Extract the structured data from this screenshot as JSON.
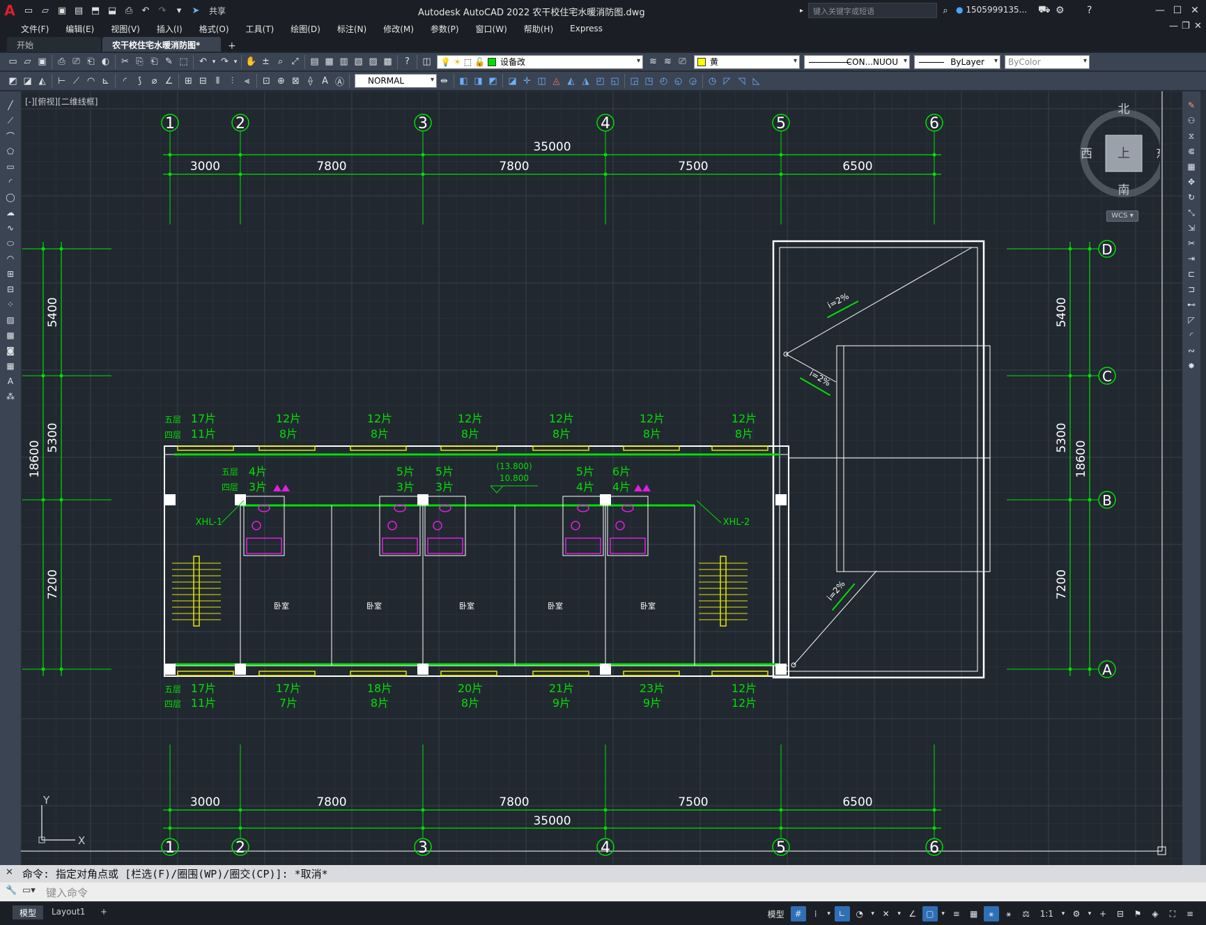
{
  "app": {
    "title": "Autodesk AutoCAD 2022    农干校住宅水暖消防图.dwg",
    "logo": "A",
    "share_label": "共享",
    "search_placeholder": "键入关键字或短语",
    "user_name": "1505999135..."
  },
  "menu": [
    "文件(F)",
    "编辑(E)",
    "视图(V)",
    "插入(I)",
    "格式(O)",
    "工具(T)",
    "绘图(D)",
    "标注(N)",
    "修改(M)",
    "参数(P)",
    "窗口(W)",
    "帮助(H)",
    "Express"
  ],
  "doc_tabs": [
    {
      "label": "开始",
      "active": false
    },
    {
      "label": "农干校住宅水暖消防图*",
      "active": true
    }
  ],
  "toolbar": {
    "layer_name": "设备改",
    "layer_color": "#00dd00",
    "color_name": "黄",
    "color_swatch": "#ffff00",
    "linetype": "CON...NUOU",
    "lineweight": "ByLayer",
    "plotstyle": "ByColor",
    "textstyle": "NORMAL"
  },
  "viewport": {
    "label": "[-][俯视][二维线框]",
    "viewcube": {
      "north": "北",
      "south": "南",
      "east": "东",
      "west": "西",
      "face": "上",
      "ucs": "WCS"
    },
    "ucs_x": "X",
    "ucs_y": "Y"
  },
  "drawing": {
    "grid_cols": [
      "1",
      "2",
      "3",
      "4",
      "5",
      "6"
    ],
    "grid_rows": [
      "D",
      "C",
      "B",
      "A"
    ],
    "col_dims": [
      "3000",
      "7800",
      "7800",
      "7500",
      "6500"
    ],
    "total_width": "35000",
    "row_dims": [
      "5400",
      "5300",
      "7200"
    ],
    "total_depth": "18600",
    "top_floor5_label": "五层",
    "top_floor4_label": "四层",
    "top_radiators": [
      {
        "f5": "17片",
        "f4": "11片"
      },
      {
        "f5": "12片",
        "f4": "8片"
      },
      {
        "f5": "12片",
        "f4": "8片"
      },
      {
        "f5": "12片",
        "f4": "8片"
      },
      {
        "f5": "12片",
        "f4": "8片"
      },
      {
        "f5": "12片",
        "f4": "8片"
      },
      {
        "f5": "12片",
        "f4": "8片"
      }
    ],
    "bottom_radiators": [
      {
        "f5": "17片",
        "f4": "11片"
      },
      {
        "f5": "17片",
        "f4": "7片"
      },
      {
        "f5": "18片",
        "f4": "8片"
      },
      {
        "f5": "20片",
        "f4": "8片"
      },
      {
        "f5": "21片",
        "f4": "9片"
      },
      {
        "f5": "23片",
        "f4": "9片"
      },
      {
        "f5": "12片",
        "f4": "12片"
      }
    ],
    "bath_radiators": [
      {
        "f5": "4片",
        "f4": "3片"
      },
      {
        "f5": "5片",
        "f4": "3片"
      },
      {
        "f5": "5片",
        "f4": "3片"
      },
      {
        "f5": "5片",
        "f4": "4片"
      },
      {
        "f5": "6片",
        "f4": "4片"
      }
    ],
    "elev_top": "(13.800)",
    "elev_bottom": "10.800",
    "riser_left": "XHL-1",
    "riser_right": "XHL-2",
    "slope": "i=2%",
    "room_label": "卧室"
  },
  "command": {
    "history": "命令: 指定对角点或 [栏选(F)/圈围(WP)/圈交(CP)]: *取消*",
    "placeholder": "键入命令"
  },
  "status": {
    "tabs": [
      {
        "label": "模型",
        "active": true
      },
      {
        "label": "Layout1",
        "active": false
      }
    ],
    "model_label": "模型",
    "scale": "1:1"
  }
}
